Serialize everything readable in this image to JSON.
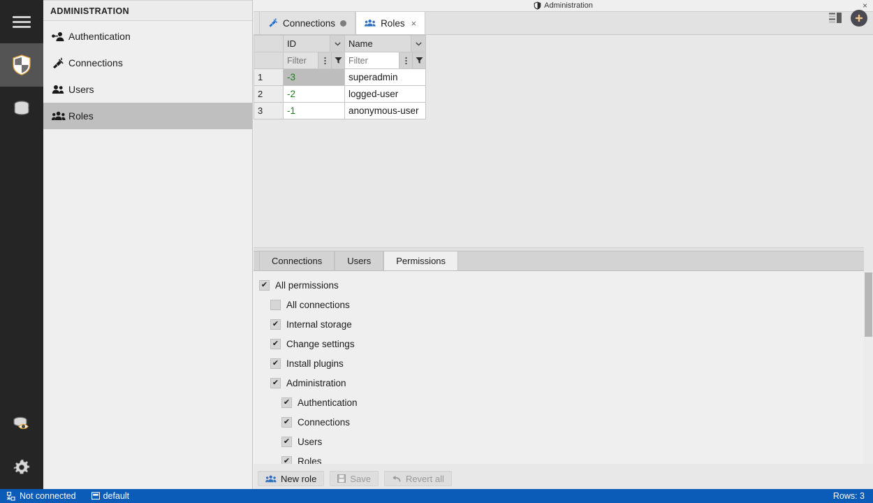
{
  "rail": {
    "items": [
      {
        "name": "menu-hamburger",
        "icon": "hamburger-icon",
        "active": false
      },
      {
        "name": "security-shield",
        "icon": "shield-icon",
        "active": true
      },
      {
        "name": "database",
        "icon": "database-icon",
        "active": false
      }
    ],
    "bottom_items": [
      {
        "name": "database-preview",
        "icon": "database-eye-icon"
      },
      {
        "name": "settings",
        "icon": "gear-icon"
      }
    ]
  },
  "sidebar": {
    "header": "ADMINISTRATION",
    "items": [
      {
        "label": "Authentication",
        "icon": "user-key-icon",
        "selected": false
      },
      {
        "label": "Connections",
        "icon": "plug-icon",
        "selected": false
      },
      {
        "label": "Users",
        "icon": "users-icon",
        "selected": false
      },
      {
        "label": "Roles",
        "icon": "roles-icon",
        "selected": true
      }
    ]
  },
  "editor": {
    "part_title": "Administration",
    "part_icon": "shield-icon",
    "close_glyph": "×",
    "tabs": [
      {
        "label": "Connections",
        "icon": "plug-icon",
        "active": false,
        "dirty_dot": true,
        "closable": false
      },
      {
        "label": "Roles",
        "icon": "roles-icon",
        "active": true,
        "dirty_dot": false,
        "closable": true
      }
    ]
  },
  "grid": {
    "columns": [
      {
        "label": "",
        "key": "rownum"
      },
      {
        "label": "ID",
        "key": "id"
      },
      {
        "label": "Name",
        "key": "name"
      }
    ],
    "filter_placeholder": "Filter",
    "filter_values": {
      "id": "",
      "name": ""
    },
    "rows": [
      {
        "rownum": "1",
        "id": "-3",
        "name": "superadmin",
        "selected_cell": "id"
      },
      {
        "rownum": "2",
        "id": "-2",
        "name": "logged-user",
        "selected_cell": ""
      },
      {
        "rownum": "3",
        "id": "-1",
        "name": "anonymous-user",
        "selected_cell": ""
      }
    ]
  },
  "lower_tabs": [
    {
      "label": "Connections",
      "active": false
    },
    {
      "label": "Users",
      "active": false
    },
    {
      "label": "Permissions",
      "active": true
    }
  ],
  "permissions": {
    "check_glyph": "✔",
    "items": [
      {
        "label": "All permissions",
        "checked": true,
        "level": 0
      },
      {
        "label": "All connections",
        "checked": false,
        "level": 1
      },
      {
        "label": "Internal storage",
        "checked": true,
        "level": 1
      },
      {
        "label": "Change settings",
        "checked": true,
        "level": 1
      },
      {
        "label": "Install plugins",
        "checked": true,
        "level": 1
      },
      {
        "label": "Administration",
        "checked": true,
        "level": 1
      },
      {
        "label": "Authentication",
        "checked": true,
        "level": 2
      },
      {
        "label": "Connections",
        "checked": true,
        "level": 2
      },
      {
        "label": "Users",
        "checked": true,
        "level": 2
      },
      {
        "label": "Roles",
        "checked": true,
        "level": 2
      }
    ]
  },
  "bottom_toolbar": {
    "buttons": [
      {
        "label": "New role",
        "icon": "roles-icon",
        "enabled": true
      },
      {
        "label": "Save",
        "icon": "save-icon",
        "enabled": false
      },
      {
        "label": "Revert all",
        "icon": "undo-icon",
        "enabled": false
      }
    ]
  },
  "top_toolbar": {
    "perspective_label": "perspective-switch",
    "add_label": "add-perspective"
  },
  "statusbar": {
    "connection_state": "Not connected",
    "connection_icon": "disconnected-icon",
    "schema": "default",
    "schema_icon": "database-small-icon",
    "rows_label": "Rows: 3",
    "background": "#0a5cb8"
  }
}
